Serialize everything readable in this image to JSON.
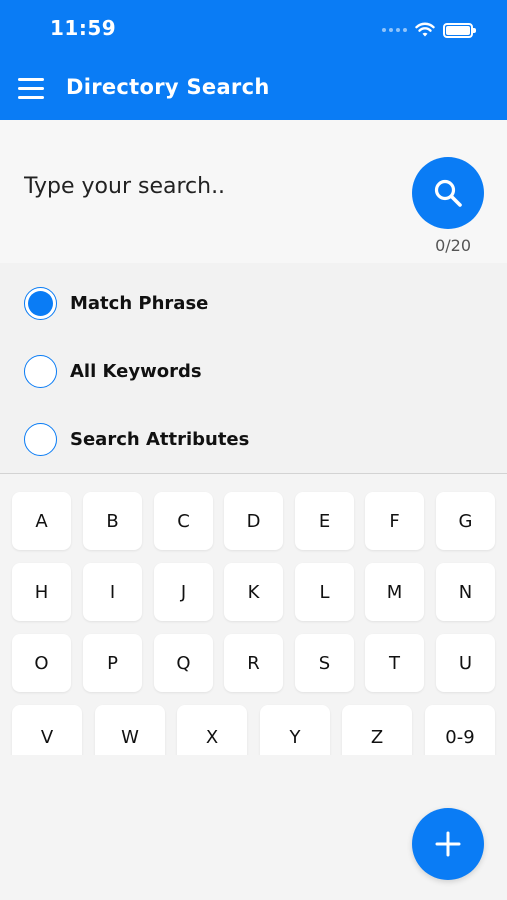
{
  "status_bar": {
    "time": "11:59"
  },
  "header": {
    "title": "Directory Search"
  },
  "search": {
    "placeholder": "Type your search..",
    "value": "",
    "counter": "0/20"
  },
  "options": [
    {
      "label": "Match Phrase",
      "selected": true
    },
    {
      "label": "All Keywords",
      "selected": false
    },
    {
      "label": "Search Attributes",
      "selected": false
    }
  ],
  "letters": {
    "row1": [
      "A",
      "B",
      "C",
      "D",
      "E",
      "F",
      "G"
    ],
    "row2": [
      "H",
      "I",
      "J",
      "K",
      "L",
      "M",
      "N"
    ],
    "row3": [
      "O",
      "P",
      "Q",
      "R",
      "S",
      "T",
      "U"
    ],
    "row4": [
      "V",
      "W",
      "X",
      "Y",
      "Z",
      "0-9"
    ]
  },
  "colors": {
    "accent": "#0a7cf5",
    "background": "#f4f4f4",
    "key": "#ffffff"
  },
  "icons": {
    "menu": "hamburger-icon",
    "search": "magnifier-icon",
    "add": "plus-icon",
    "wifi": "wifi-icon",
    "battery": "battery-icon"
  }
}
